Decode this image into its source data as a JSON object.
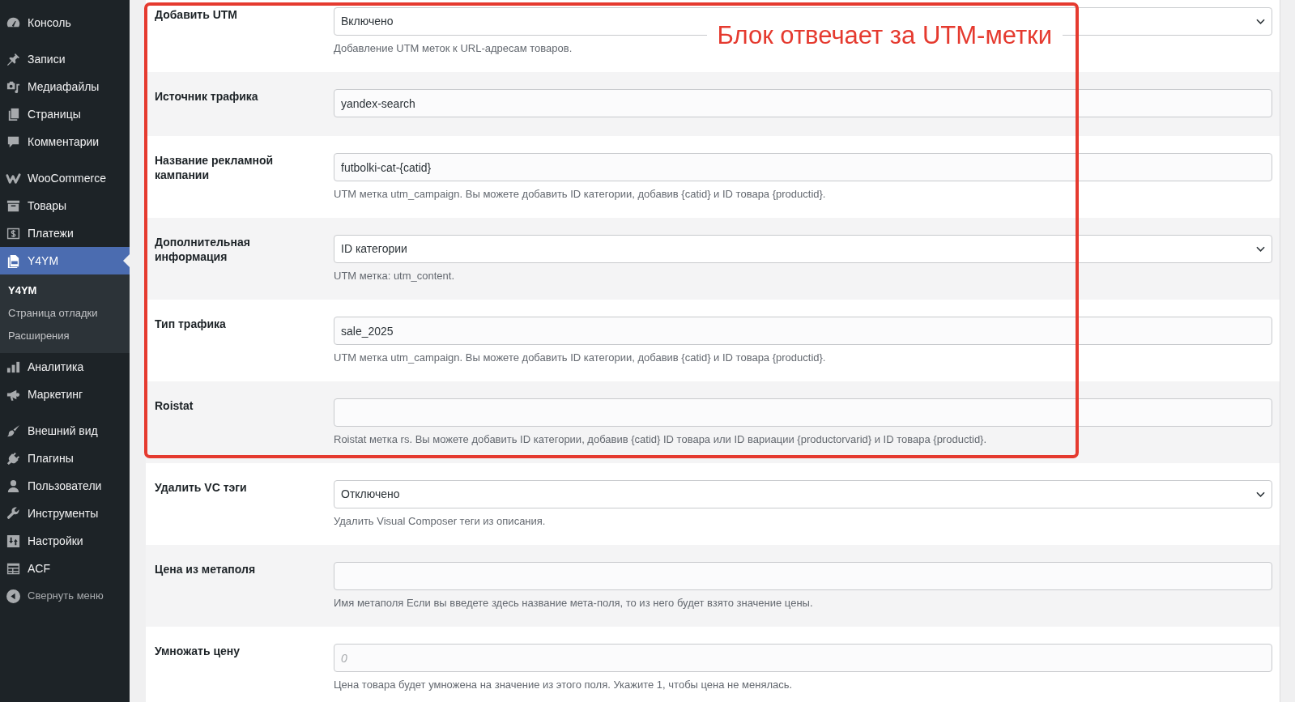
{
  "sidebar": {
    "groups": [
      {
        "items": [
          {
            "label": "Консоль",
            "selected": false
          }
        ]
      },
      {
        "items": [
          {
            "label": "Записи",
            "selected": false
          },
          {
            "label": "Медиафайлы",
            "selected": false
          },
          {
            "label": "Страницы",
            "selected": false
          },
          {
            "label": "Комментарии",
            "selected": false
          }
        ]
      },
      {
        "items": [
          {
            "label": "WooCommerce",
            "selected": false
          },
          {
            "label": "Товары",
            "selected": false
          },
          {
            "label": "Платежи",
            "selected": false
          },
          {
            "label": "Y4YM",
            "selected": true,
            "children": [
              {
                "label": "Y4YM",
                "selected": true
              },
              {
                "label": "Страница отладки",
                "selected": false
              },
              {
                "label": "Расширения",
                "selected": false
              }
            ]
          },
          {
            "label": "Аналитика",
            "selected": false
          },
          {
            "label": "Маркетинг",
            "selected": false
          }
        ]
      },
      {
        "items": [
          {
            "label": "Внешний вид",
            "selected": false
          },
          {
            "label": "Плагины",
            "selected": false
          },
          {
            "label": "Пользователи",
            "selected": false
          },
          {
            "label": "Инструменты",
            "selected": false
          },
          {
            "label": "Настройки",
            "selected": false
          },
          {
            "label": "ACF",
            "selected": false
          }
        ]
      }
    ],
    "collapse": {
      "label": "Свернуть меню"
    }
  },
  "settings": {
    "rows": [
      {
        "label": "Добавить UTM",
        "kind": "select",
        "value": "Включено",
        "description": "Добавление UTM меток к URL-адресам товаров.",
        "highlighted": true
      },
      {
        "label": "Источник трафика",
        "kind": "text",
        "value": "yandex-search",
        "highlighted": true
      },
      {
        "label": "Название рекламной кампании",
        "kind": "text",
        "value": "futbolki-cat-{catid}",
        "description": "UTM метка utm_campaign. Вы можете добавить ID категории, добавив {catid} и ID товара {productid}.",
        "highlighted": true
      },
      {
        "label": "Дополнительная информация",
        "kind": "select",
        "value": "ID категории",
        "description": "UTM метка: utm_content.",
        "highlighted": true
      },
      {
        "label": "Тип трафика",
        "kind": "text",
        "value": "sale_2025",
        "description": "UTM метка utm_campaign. Вы можете добавить ID категории, добавив {catid} и ID товара {productid}.",
        "highlighted": true
      },
      {
        "label": "Roistat",
        "kind": "text",
        "description": "Roistat метка rs. Вы можете добавить ID категории, добавив {catid} ID товара или ID вариации {productorvarid} и ID товара {productid}.",
        "highlighted": true
      },
      {
        "label": "Удалить VC тэги",
        "kind": "select",
        "value": "Отключено",
        "description": "Удалить Visual Composer теги из описания.",
        "highlighted": false
      },
      {
        "label": "Цена из метаполя",
        "kind": "text",
        "description": "Имя метаполя Если вы введете здесь название мета-поля, то из него будет взято значение цены.",
        "highlighted": false
      },
      {
        "label": "Умножать цену",
        "kind": "text",
        "placeholder": "0",
        "description": "Цена товара будет умножена на значение из этого поля. Укажите 1, чтобы цена не менялась.",
        "highlighted": false
      }
    ]
  },
  "annotation": {
    "text": "Блок отвечает за UTM-метки"
  }
}
